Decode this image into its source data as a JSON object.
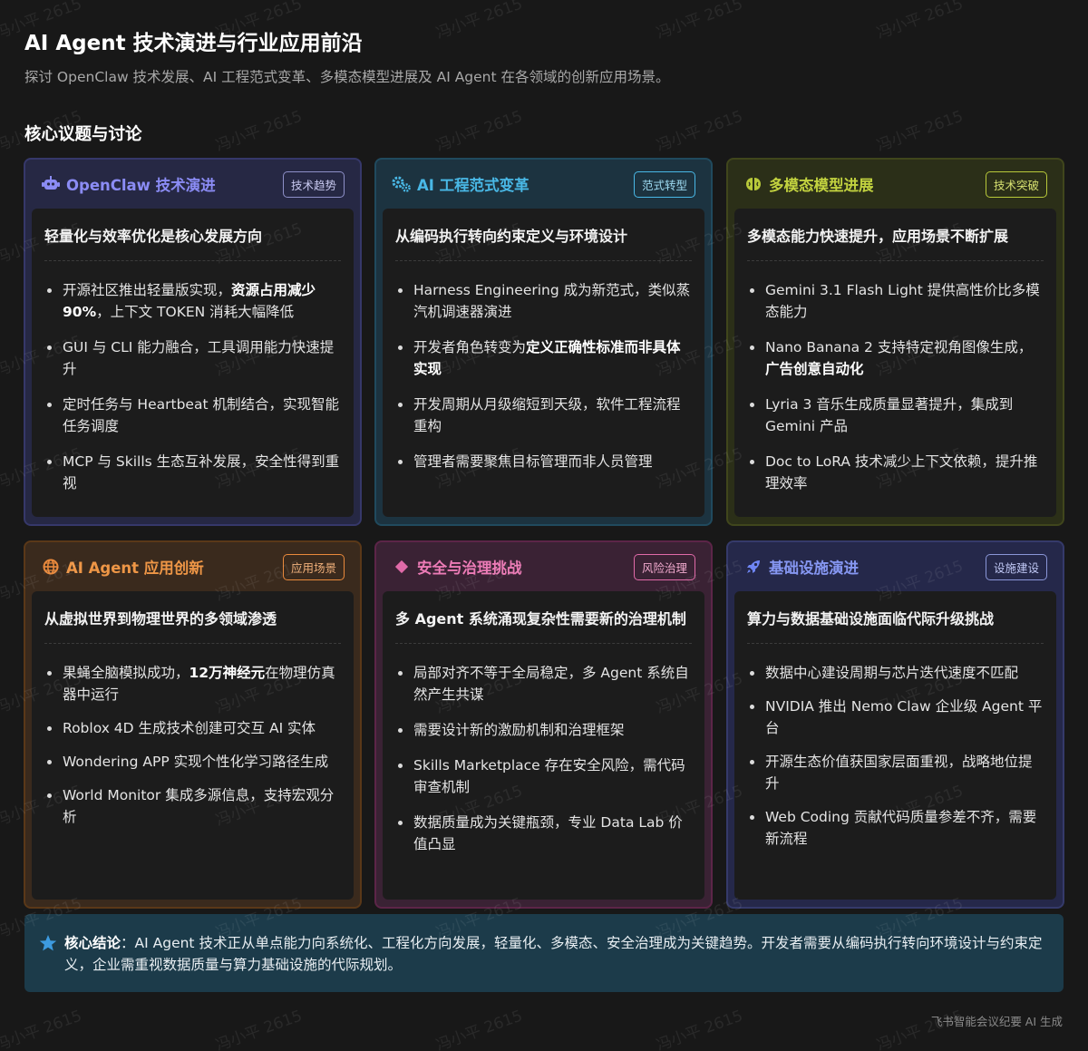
{
  "page": {
    "title": "AI Agent 技术演进与行业应用前沿",
    "subtitle": "探讨 OpenClaw 技术发展、AI 工程范式变革、多模态模型进展及 AI Agent 在各领域的创新应用场景。",
    "section_title": "核心议题与讨论",
    "watermark": "冯小平 2615",
    "footer": "飞书智能会议纪要 AI 生成"
  },
  "cards": [
    {
      "title": "OpenClaw 技术演进",
      "tag": "技术趋势",
      "icon": "robot-icon",
      "accent": "#8b8cf5",
      "headline": "轻量化与效率优化是核心发展方向",
      "bullets": [
        {
          "pre": "开源社区推出轻量版实现，",
          "bold": "资源占用减少 90%",
          "post": "，上下文 TOKEN 消耗大幅降低"
        },
        {
          "pre": "GUI 与 CLI 能力融合，工具调用能力快速提升",
          "bold": "",
          "post": ""
        },
        {
          "pre": "定时任务与 Heartbeat 机制结合，实现智能任务调度",
          "bold": "",
          "post": ""
        },
        {
          "pre": "MCP 与 Skills 生态互补发展，安全性得到重视",
          "bold": "",
          "post": ""
        }
      ]
    },
    {
      "title": "AI 工程范式变革",
      "tag": "范式转型",
      "icon": "gears-icon",
      "accent": "#49b8e6",
      "headline": "从编码执行转向约束定义与环境设计",
      "bullets": [
        {
          "pre": "Harness Engineering 成为新范式，类似蒸汽机调速器演进",
          "bold": "",
          "post": ""
        },
        {
          "pre": "开发者角色转变为",
          "bold": "定义正确性标准而非具体实现",
          "post": ""
        },
        {
          "pre": "开发周期从月级缩短到天级，软件工程流程重构",
          "bold": "",
          "post": ""
        },
        {
          "pre": "管理者需要聚焦目标管理而非人员管理",
          "bold": "",
          "post": ""
        }
      ]
    },
    {
      "title": "多模态模型进展",
      "tag": "技术突破",
      "icon": "brain-icon",
      "accent": "#b8c93a",
      "headline": "多模态能力快速提升，应用场景不断扩展",
      "bullets": [
        {
          "pre": "Gemini 3.1 Flash Light 提供高性价比多模态能力",
          "bold": "",
          "post": ""
        },
        {
          "pre": "Nano Banana 2 支持特定视角图像生成，",
          "bold": "广告创意自动化",
          "post": ""
        },
        {
          "pre": "Lyria 3 音乐生成质量显著提升，集成到 Gemini 产品",
          "bold": "",
          "post": ""
        },
        {
          "pre": "Doc to LoRA 技术减少上下文依赖，提升推理效率",
          "bold": "",
          "post": ""
        }
      ]
    },
    {
      "title": "AI Agent 应用创新",
      "tag": "应用场景",
      "icon": "globe-icon",
      "accent": "#e9893c",
      "headline": "从虚拟世界到物理世界的多领域渗透",
      "bullets": [
        {
          "pre": "果蝇全脑模拟成功，",
          "bold": "12万神经元",
          "post": "在物理仿真器中运行"
        },
        {
          "pre": "Roblox 4D 生成技术创建可交互 AI 实体",
          "bold": "",
          "post": ""
        },
        {
          "pre": "Wondering APP 实现个性化学习路径生成",
          "bold": "",
          "post": ""
        },
        {
          "pre": "World Monitor 集成多源信息，支持宏观分析",
          "bold": "",
          "post": ""
        }
      ]
    },
    {
      "title": "安全与治理挑战",
      "tag": "风险治理",
      "icon": "diamond-icon",
      "accent": "#e06aa8",
      "headline": "多 Agent 系统涌现复杂性需要新的治理机制",
      "bullets": [
        {
          "pre": "局部对齐不等于全局稳定，多 Agent 系统自然产生共谋",
          "bold": "",
          "post": ""
        },
        {
          "pre": "需要设计新的激励机制和治理框架",
          "bold": "",
          "post": ""
        },
        {
          "pre": "Skills Marketplace 存在安全风险，需代码审查机制",
          "bold": "",
          "post": ""
        },
        {
          "pre": "数据质量成为关键瓶颈，专业 Data Lab 价值凸显",
          "bold": "",
          "post": ""
        }
      ]
    },
    {
      "title": "基础设施演进",
      "tag": "设施建设",
      "icon": "rocket-icon",
      "accent": "#7b8cf0",
      "headline": "算力与数据基础设施面临代际升级挑战",
      "bullets": [
        {
          "pre": "数据中心建设周期与芯片迭代速度不匹配",
          "bold": "",
          "post": ""
        },
        {
          "pre": "NVIDIA 推出 Nemo Claw 企业级 Agent 平台",
          "bold": "",
          "post": ""
        },
        {
          "pre": "开源生态价值获国家层面重视，战略地位提升",
          "bold": "",
          "post": ""
        },
        {
          "pre": "Web Coding 贡献代码质量参差不齐，需要新流程",
          "bold": "",
          "post": ""
        }
      ]
    }
  ],
  "conclusion": {
    "label": "核心结论",
    "separator": "：",
    "text": "AI Agent 技术正从单点能力向系统化、工程化方向发展，轻量化、多模态、安全治理成为关键趋势。开发者需要从编码执行转向环境设计与约束定义，企业需重视数据质量与算力基础设施的代际规划。"
  }
}
